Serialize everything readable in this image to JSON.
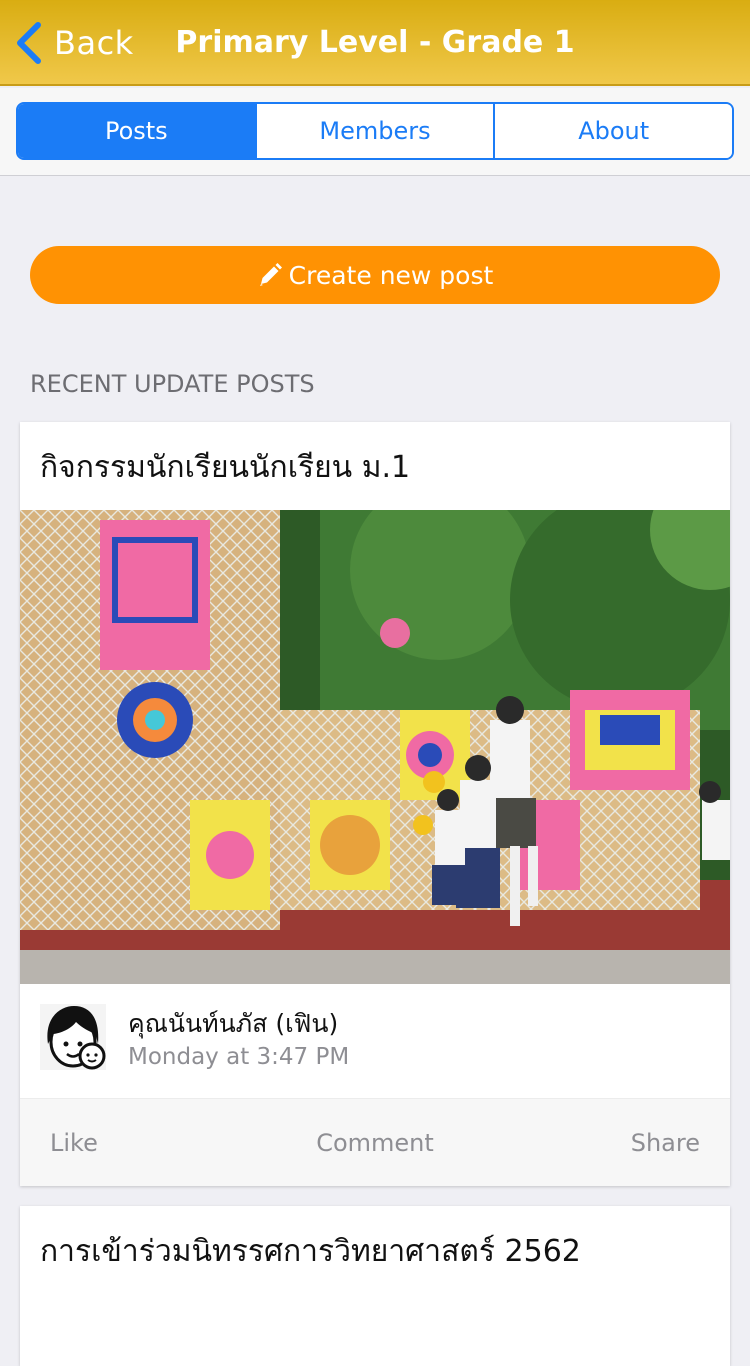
{
  "navbar": {
    "back_label": "Back",
    "title": "Primary Level - Grade 1",
    "icon": "chevron-left-icon",
    "colors": {
      "bar": "#f0c84a",
      "text": "#ffffff",
      "back_arrow": "#1b7cf6"
    }
  },
  "tabs": [
    {
      "label": "Posts",
      "active": true
    },
    {
      "label": "Members",
      "active": false
    },
    {
      "label": "About",
      "active": false
    }
  ],
  "create_button": {
    "label": "Create new post",
    "icon": "pencil-icon",
    "color": "#ff9203"
  },
  "section_title": "RECENT UPDATE POSTS",
  "posts": [
    {
      "title": "กิจกรรมนักเรียนนักเรียน ม.1",
      "image": "students-playing-ball-photo",
      "author": "คุณนันท์นภัส (เฟิน)",
      "time": "Monday at 3:47 PM",
      "actions": {
        "like": "Like",
        "comment": "Comment",
        "share": "Share"
      }
    },
    {
      "title": "การเข้าร่วมนิทรรศการวิทยาศาสตร์ 2562"
    }
  ]
}
